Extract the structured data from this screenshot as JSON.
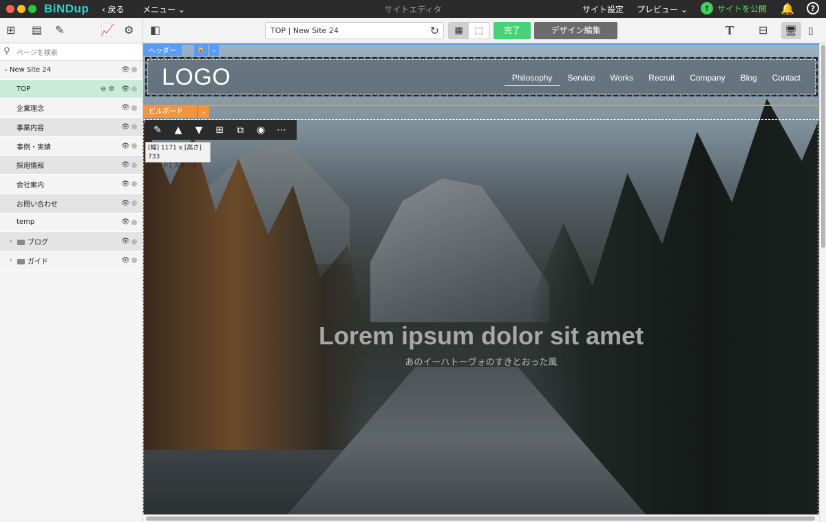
{
  "app": {
    "brand": "BiNDup",
    "back_label": "戻る",
    "menu_label": "メニュー",
    "window_title": "サイトエディタ",
    "site_settings": "サイト設定",
    "preview_label": "プレビュー",
    "publish_label": "サイトを公開",
    "help_label": "?"
  },
  "toolbar": {
    "url_text": "TOP | New Site 24",
    "done_label": "完了",
    "design_edit_label": "デザイン編集",
    "text_tool_label": "T"
  },
  "sidebar": {
    "search_placeholder": "ページを検索",
    "pages": [
      {
        "label": "New Site 24",
        "kind": "root"
      },
      {
        "label": "TOP",
        "kind": "selected"
      },
      {
        "label": "企業理念",
        "kind": "page"
      },
      {
        "label": "事業内容",
        "kind": "page"
      },
      {
        "label": "事例・実績",
        "kind": "page"
      },
      {
        "label": "採用情報",
        "kind": "page"
      },
      {
        "label": "会社案内",
        "kind": "page"
      },
      {
        "label": "お問い合わせ",
        "kind": "page"
      },
      {
        "label": "temp",
        "kind": "page"
      },
      {
        "label": "ブログ",
        "kind": "folder"
      },
      {
        "label": "ガイド",
        "kind": "folder"
      }
    ]
  },
  "canvas": {
    "header_tag": "ヘッダー",
    "billboard_tag": "ビルボード",
    "logo": "LOGO",
    "nav": [
      "Philosophy",
      "Service",
      "Works",
      "Recruit",
      "Company",
      "Blog",
      "Contact"
    ],
    "size_info_line1": "[幅] 1171 x [高さ] 733",
    "size_info_line2": "[モード] スマート",
    "hero_title": "Lorem ipsum dolor sit amet",
    "hero_subtitle": "あのイーハトーヴォのすきとおった風"
  },
  "colors": {
    "accent_green": "#47d178",
    "header_tag_blue": "#5b9cf3",
    "billboard_tag_orange": "#f3953a",
    "brand_teal": "#2fd2c8"
  }
}
